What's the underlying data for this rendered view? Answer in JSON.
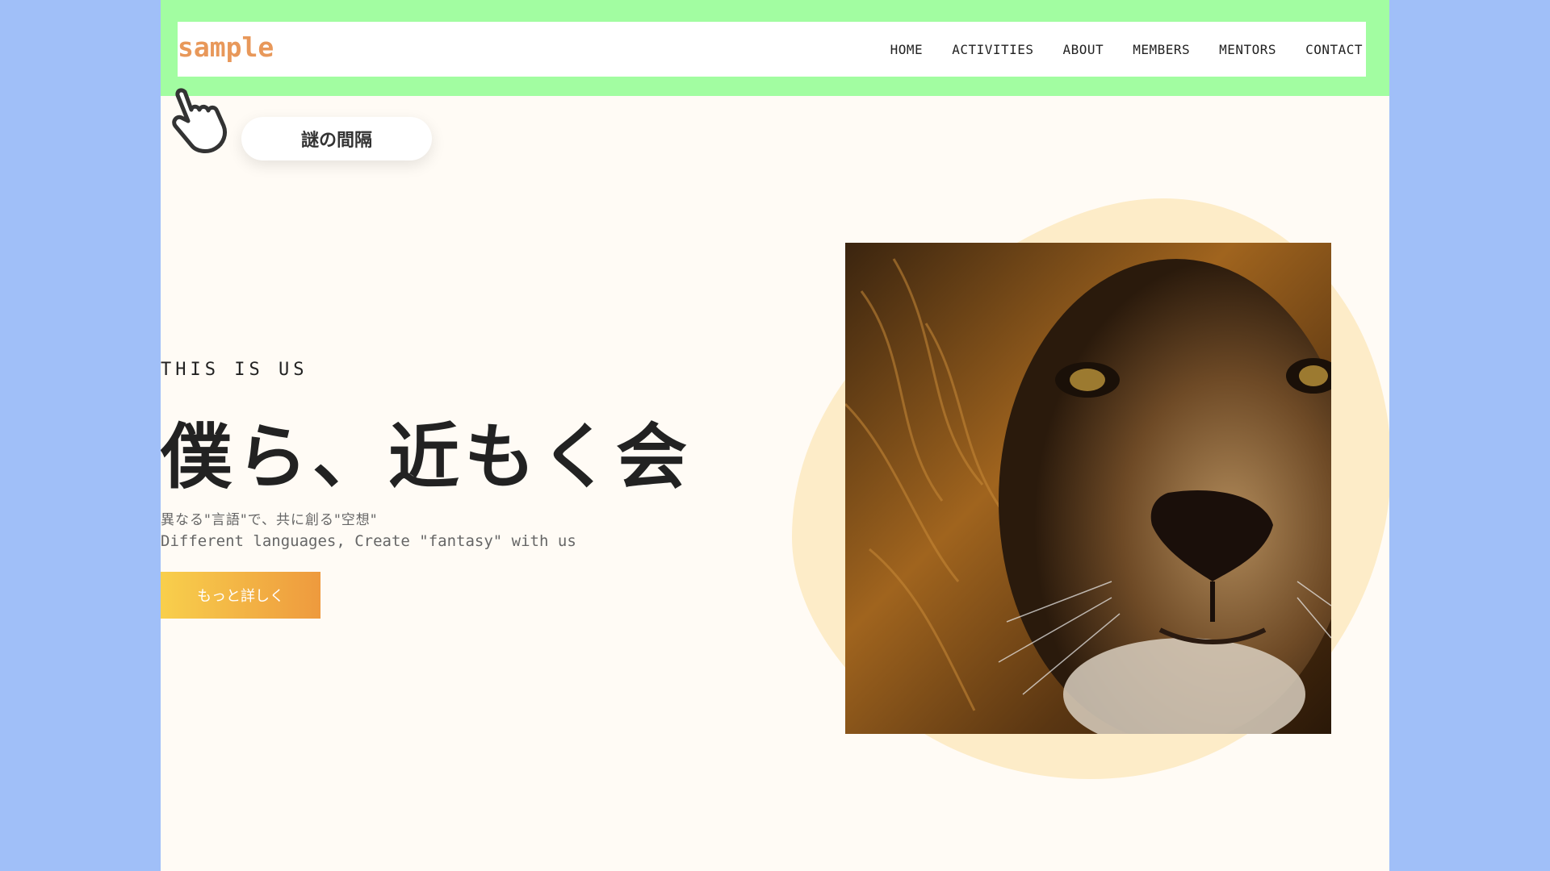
{
  "header": {
    "logo": "sample",
    "nav": [
      "HOME",
      "ACTIVITIES",
      "ABOUT",
      "MEMBERS",
      "MENTORS",
      "CONTACT"
    ]
  },
  "annotation": {
    "label": "謎の間隔",
    "icon": "pointer-hand-icon"
  },
  "hero": {
    "eyebrow": "THIS IS US",
    "headline": "僕ら、近もく会",
    "subtitle_ja": "異なる\"言語\"で、共に創る\"空想\"",
    "subtitle_en": "Different languages, Create \"fantasy\" with us",
    "cta_label": "もっと詳しく",
    "image_alt": "lion-face-photo"
  },
  "colors": {
    "background": "#a0bff8",
    "header_band": "#a2fda1",
    "page": "#fffbf5",
    "logo": "#e8985a",
    "blob": "#fdecc8",
    "cta_start": "#f8cf4c",
    "cta_end": "#ee9a3e"
  }
}
